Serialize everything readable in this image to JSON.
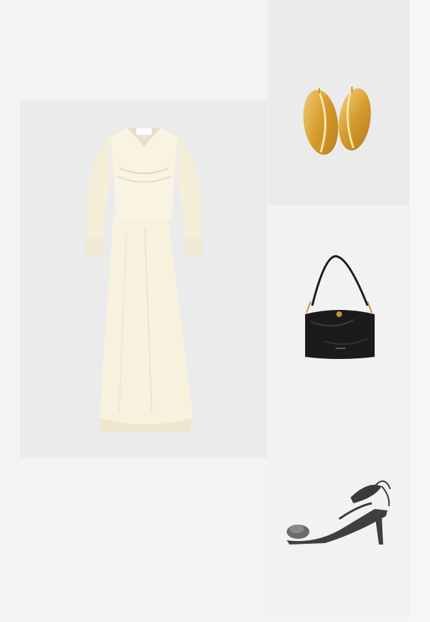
{
  "layout_name": "outfit-collage",
  "products": [
    {
      "id": "dress",
      "icon": "dress-icon",
      "color": "#f6f0dc"
    },
    {
      "id": "earrings",
      "icon": "earring-icon",
      "color": "#d9a63c"
    },
    {
      "id": "bag",
      "icon": "handbag-icon",
      "color": "#1b1b1d"
    },
    {
      "id": "sandals",
      "icon": "sandal-icon",
      "color": "#3f3f42"
    }
  ],
  "bag_logo_text": "",
  "dress_label_text": ""
}
